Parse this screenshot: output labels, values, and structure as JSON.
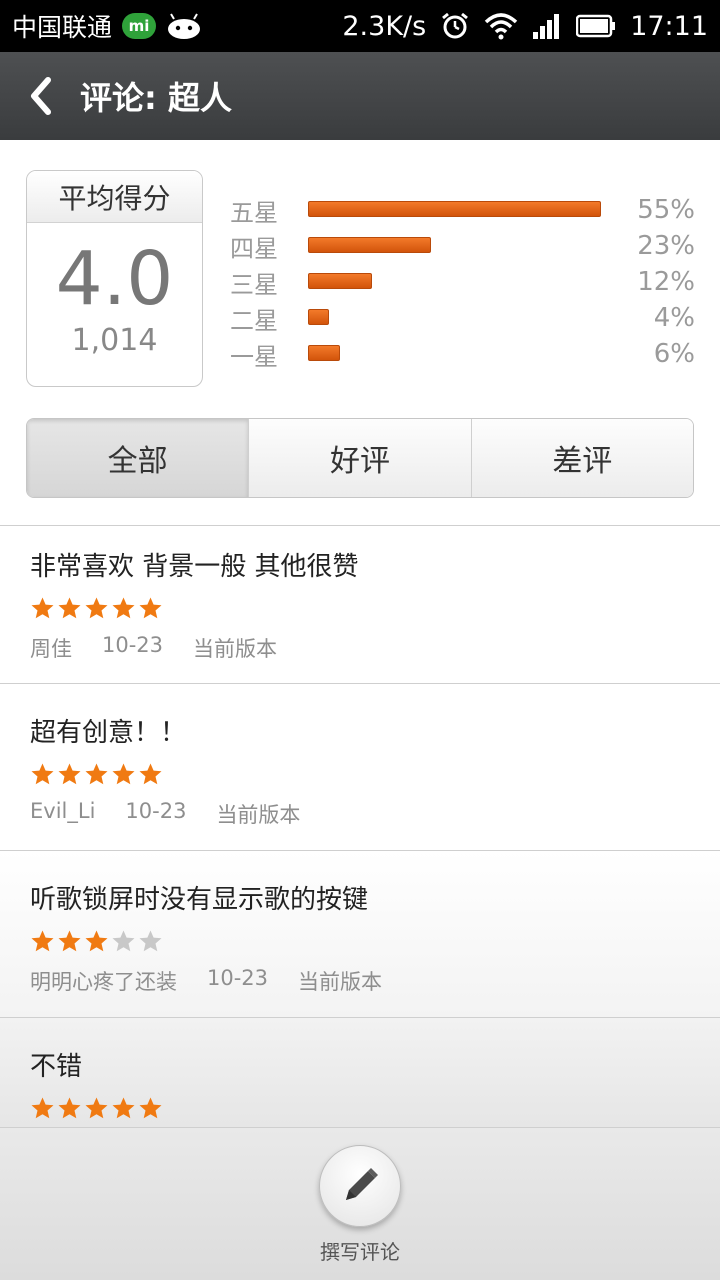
{
  "status_bar": {
    "carrier": "中国联通",
    "mi_badge": "mi",
    "speed": "2.3K/s",
    "time": "17:11"
  },
  "title_bar": {
    "title": "评论: 超人"
  },
  "summary": {
    "avg_label": "平均得分",
    "avg_score": "4.0",
    "count": "1,014",
    "rows": [
      {
        "label": "五星",
        "pct_text": "55%",
        "value": 0.55
      },
      {
        "label": "四星",
        "pct_text": "23%",
        "value": 0.23
      },
      {
        "label": "三星",
        "pct_text": "12%",
        "value": 0.12
      },
      {
        "label": "二星",
        "pct_text": "4%",
        "value": 0.04
      },
      {
        "label": "一星",
        "pct_text": "6%",
        "value": 0.06
      }
    ],
    "bar_color": "#e2620f"
  },
  "tabs": [
    {
      "label": "全部",
      "active": true
    },
    {
      "label": "好评",
      "active": false
    },
    {
      "label": "差评",
      "active": false
    }
  ],
  "reviews": [
    {
      "text": "非常喜欢 背景一般 其他很赞",
      "stars": 5,
      "user": "周佳",
      "date": "10-23",
      "version": "当前版本"
    },
    {
      "text": "超有创意！！",
      "stars": 5,
      "user": "Evil_Li",
      "date": "10-23",
      "version": "当前版本"
    },
    {
      "text": "听歌锁屏时没有显示歌的按键",
      "stars": 3,
      "user": "明明心疼了还装",
      "date": "10-23",
      "version": "当前版本"
    },
    {
      "text": "不错",
      "stars": 5,
      "user": "",
      "date": "",
      "version": ""
    }
  ],
  "star_colors": {
    "filled": "#f07a12",
    "empty": "#c8c8c8"
  },
  "bottom": {
    "write_label": "撰写评论"
  }
}
